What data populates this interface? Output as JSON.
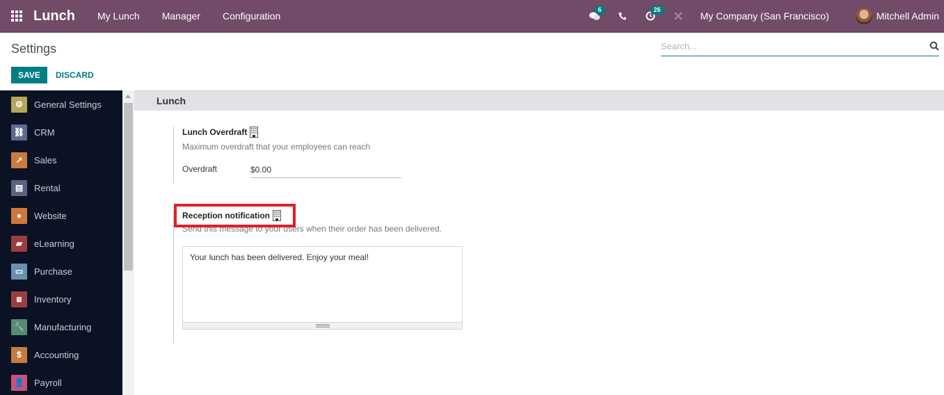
{
  "navbar": {
    "brand": "Lunch",
    "menu": [
      "My Lunch",
      "Manager",
      "Configuration"
    ],
    "messages_badge": "6",
    "activity_badge": "26",
    "company": "My Company (San Francisco)",
    "user": "Mitchell Admin",
    "icons": [
      "apps-grid-icon",
      "chat-icon",
      "phone-icon",
      "activity-clock-icon",
      "debug-tools-icon",
      "avatar"
    ]
  },
  "control_panel": {
    "title": "Settings",
    "search_placeholder": "Search...",
    "save_label": "SAVE",
    "discard_label": "DISCARD"
  },
  "sidebar": {
    "items": [
      {
        "label": "General Settings",
        "icon": "gear-icon",
        "color": "#b7a55a",
        "glyph": "⚙"
      },
      {
        "label": "CRM",
        "icon": "handshake-icon",
        "color": "#5f6a8c",
        "glyph": "⛓"
      },
      {
        "label": "Sales",
        "icon": "chart-line-icon",
        "color": "#c97a42",
        "glyph": "↗"
      },
      {
        "label": "Rental",
        "icon": "calendar-icon",
        "color": "#5a6380",
        "glyph": "▤"
      },
      {
        "label": "Website",
        "icon": "globe-icon",
        "color": "#d0783c",
        "glyph": "●"
      },
      {
        "label": "eLearning",
        "icon": "elearning-icon",
        "color": "#9b3d3f",
        "glyph": "▰"
      },
      {
        "label": "Purchase",
        "icon": "credit-card-icon",
        "color": "#6b8fb0",
        "glyph": "▭"
      },
      {
        "label": "Inventory",
        "icon": "box-icon",
        "color": "#9b3d3f",
        "glyph": "⧈"
      },
      {
        "label": "Manufacturing",
        "icon": "wrench-icon",
        "color": "#5a8a6e",
        "glyph": "🔧"
      },
      {
        "label": "Accounting",
        "icon": "invoice-icon",
        "color": "#c97a42",
        "glyph": "$"
      },
      {
        "label": "Payroll",
        "icon": "payroll-icon",
        "color": "#c9527a",
        "glyph": "👤"
      }
    ]
  },
  "content": {
    "section_title": "Lunch",
    "overdraft": {
      "title": "Lunch Overdraft",
      "description": "Maximum overdraft that your employees can reach",
      "field_label": "Overdraft",
      "field_value": "$0.00"
    },
    "reception": {
      "title": "Reception notification",
      "description": "Send this message to your users when their order has been delivered.",
      "message": "Your lunch has been delivered. Enjoy your meal!"
    }
  },
  "colors": {
    "navbar": "#714b67",
    "accent": "#017e84",
    "highlight": "#e0202a",
    "sidebar": "#0a1224"
  }
}
